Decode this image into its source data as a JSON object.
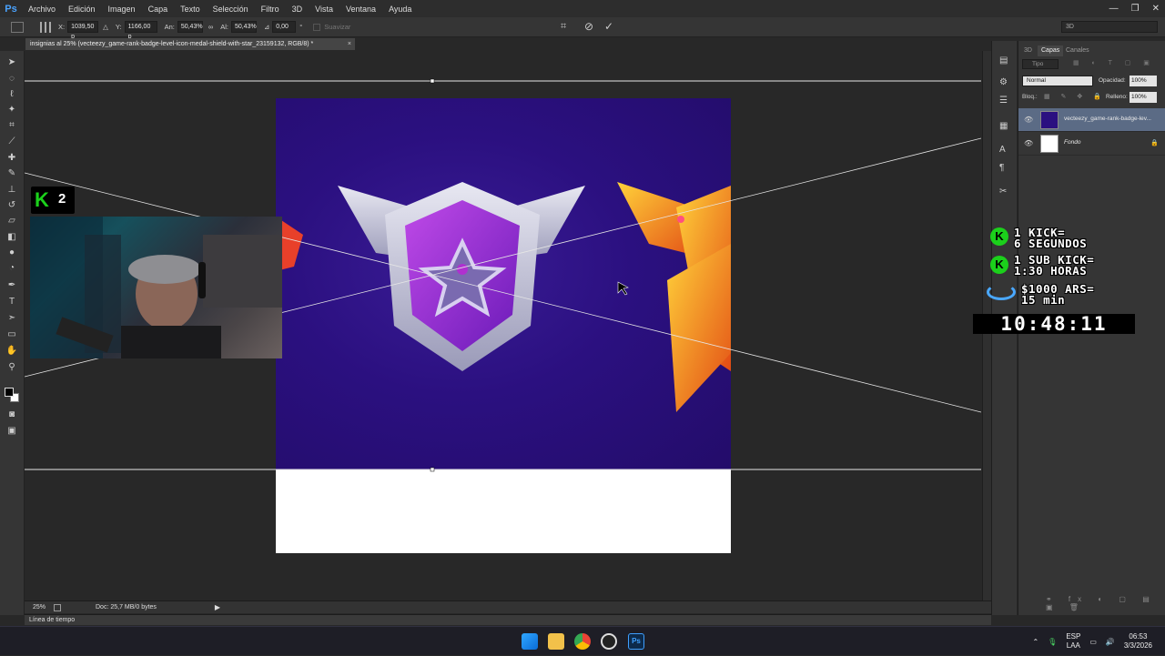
{
  "app": {
    "logo": "Ps"
  },
  "menu": [
    "Archivo",
    "Edición",
    "Imagen",
    "Capa",
    "Texto",
    "Selección",
    "Filtro",
    "3D",
    "Vista",
    "Ventana",
    "Ayuda"
  ],
  "window_controls": {
    "minimize": "—",
    "restore": "❐",
    "close": "✕"
  },
  "options": {
    "x_label": "X:",
    "x_value": "1039,50 p",
    "y_label": "Y:",
    "y_value": "1166,00 p",
    "w_label": "An:",
    "w_value": "50,43%",
    "h_label": "Al:",
    "h_value": "50,43%",
    "angle_value": "0,00",
    "angle_unit": "°",
    "smooth_label": "Suavizar",
    "workspace": "3D"
  },
  "document_tab": {
    "title": "insignias al 25% (vecteezy_game-rank-badge-level-icon-medal-shield-with-star_23159132, RGB/8) *",
    "close": "×"
  },
  "status": {
    "zoom": "25%",
    "doc": "Doc: 25,7 MB/0 bytes"
  },
  "timeline_label": "Línea de tiempo",
  "layers_panel": {
    "tabs": [
      "3D",
      "Capas",
      "Canales"
    ],
    "filter": "Tipo",
    "blend_mode": "Normal",
    "opacity_label": "Opacidad:",
    "opacity_value": "100%",
    "lock_label": "Bloq.:",
    "fill_label": "Relleno:",
    "fill_value": "100%",
    "layers": [
      {
        "name": "vecteezy_game-rank-badge-lev..."
      },
      {
        "name": "Fondo"
      }
    ]
  },
  "overlay": {
    "kick_line1a": "1 KICK=",
    "kick_line1b": "6 SEGUNDOS",
    "kick_line2a": "1 SUB KICK=",
    "kick_line2b": "1:30 HORAS",
    "ars_line_a": "$1000 ARS=",
    "ars_line_b": "15 min",
    "timer": "10:48:11"
  },
  "kick_badge": {
    "letter": "K",
    "count": "2"
  },
  "taskbar": {
    "lang_top": "ESP",
    "lang_bottom": "LAA",
    "time": "06:53",
    "date": "3/3/2026"
  },
  "colors": {
    "accent_ps": "#4aa3ff",
    "kick_green": "#1bd01b",
    "canvas_purple": "#2b1080"
  }
}
